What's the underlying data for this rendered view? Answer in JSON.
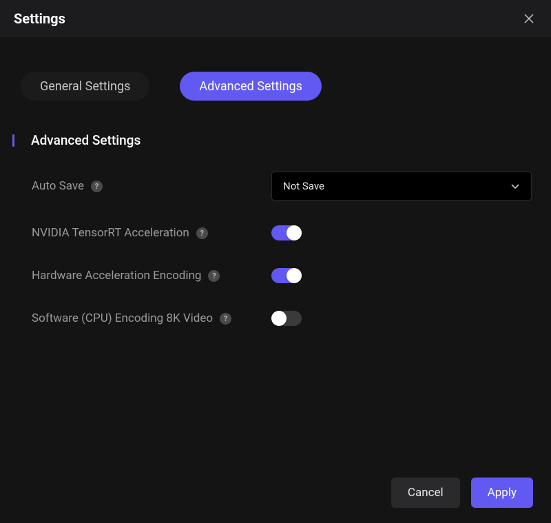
{
  "header": {
    "title": "Settings"
  },
  "tabs": {
    "general": "General Settings",
    "advanced": "Advanced Settings",
    "active": "advanced"
  },
  "section": {
    "heading": "Advanced Settings"
  },
  "settings": {
    "autosave": {
      "label": "Auto Save",
      "selected": "Not Save"
    },
    "tensorrt": {
      "label": "NVIDIA TensorRT Acceleration",
      "on": true
    },
    "hwencode": {
      "label": "Hardware Acceleration Encoding",
      "on": true
    },
    "swencode8k": {
      "label": "Software (CPU) Encoding 8K Video",
      "on": false
    }
  },
  "footer": {
    "cancel": "Cancel",
    "apply": "Apply"
  },
  "colors": {
    "accent": "#6159f1",
    "bg": "#141414",
    "header_bg": "#1c1c1f"
  }
}
